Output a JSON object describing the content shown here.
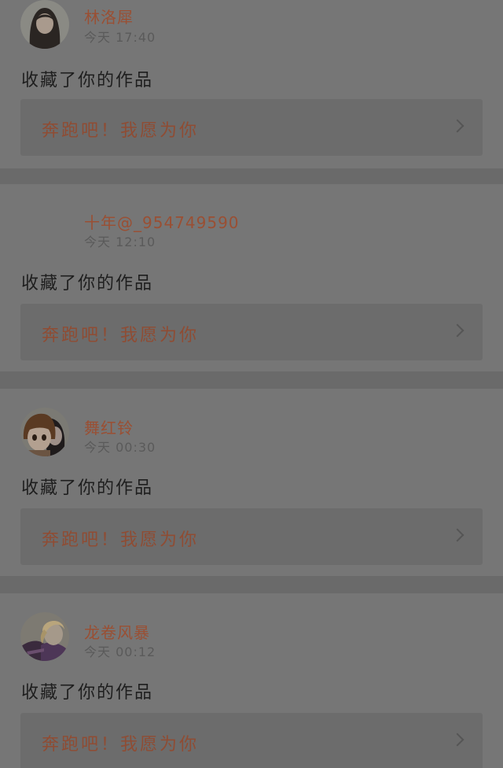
{
  "notifications": [
    {
      "username": "林洛犀",
      "time": "今天 17:40",
      "action": "收藏了你的作品",
      "work_title": "奔跑吧！我愿为你",
      "avatar": "photo-avatar"
    },
    {
      "username": "十年@_954749590",
      "time": "今天 12:10",
      "action": "收藏了你的作品",
      "work_title": "奔跑吧！我愿为你",
      "avatar": "blank-avatar"
    },
    {
      "username": "舞红铃",
      "time": "今天 00:30",
      "action": "收藏了你的作品",
      "work_title": "奔跑吧！我愿为你",
      "avatar": "anime-avatar"
    },
    {
      "username": "龙卷风暴",
      "time": "今天 00:12",
      "action": "收藏了你的作品",
      "work_title": "奔跑吧！我愿为你",
      "avatar": "anime-avatar"
    }
  ]
}
